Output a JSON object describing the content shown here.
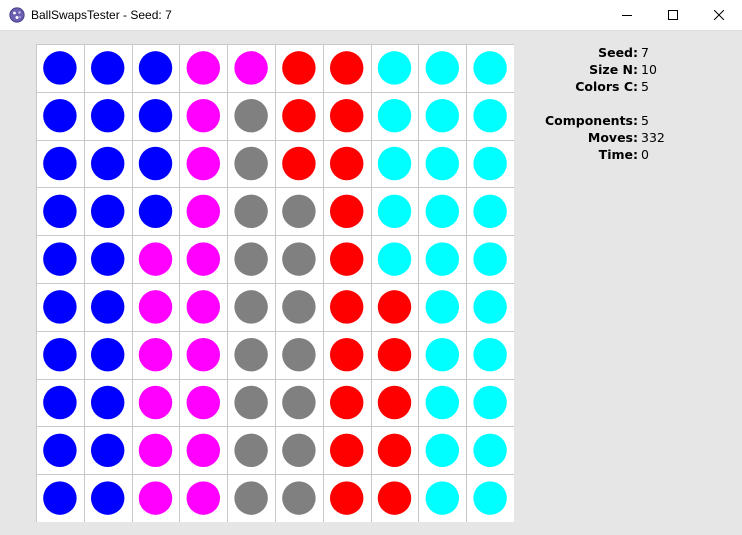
{
  "window": {
    "title": "BallSwapsTester - Seed: 7",
    "icon": "app-icon",
    "controls": [
      "minimize-icon",
      "maximize-icon",
      "close-icon"
    ]
  },
  "info": {
    "seed_label": "Seed:",
    "seed": "7",
    "size_label": "Size N:",
    "size": "10",
    "colors_label": "Colors C:",
    "colors": "5",
    "components_label": "Components:",
    "components": "5",
    "moves_label": "Moves:",
    "moves": "332",
    "time_label": "Time:",
    "time": "0"
  },
  "palette": {
    "B": "#0000ff",
    "M": "#ff00ff",
    "R": "#ff0000",
    "C": "#00ffff",
    "G": "#808080"
  },
  "grid": [
    [
      "B",
      "B",
      "B",
      "M",
      "M",
      "R",
      "R",
      "C",
      "C",
      "C"
    ],
    [
      "B",
      "B",
      "B",
      "M",
      "G",
      "R",
      "R",
      "C",
      "C",
      "C"
    ],
    [
      "B",
      "B",
      "B",
      "M",
      "G",
      "R",
      "R",
      "C",
      "C",
      "C"
    ],
    [
      "B",
      "B",
      "B",
      "M",
      "G",
      "G",
      "R",
      "C",
      "C",
      "C"
    ],
    [
      "B",
      "B",
      "M",
      "M",
      "G",
      "G",
      "R",
      "C",
      "C",
      "C"
    ],
    [
      "B",
      "B",
      "M",
      "M",
      "G",
      "G",
      "R",
      "R",
      "C",
      "C"
    ],
    [
      "B",
      "B",
      "M",
      "M",
      "G",
      "G",
      "R",
      "R",
      "C",
      "C"
    ],
    [
      "B",
      "B",
      "M",
      "M",
      "G",
      "G",
      "R",
      "R",
      "C",
      "C"
    ],
    [
      "B",
      "B",
      "M",
      "M",
      "G",
      "G",
      "R",
      "R",
      "C",
      "C"
    ],
    [
      "B",
      "B",
      "M",
      "M",
      "G",
      "G",
      "R",
      "R",
      "C",
      "C"
    ]
  ]
}
